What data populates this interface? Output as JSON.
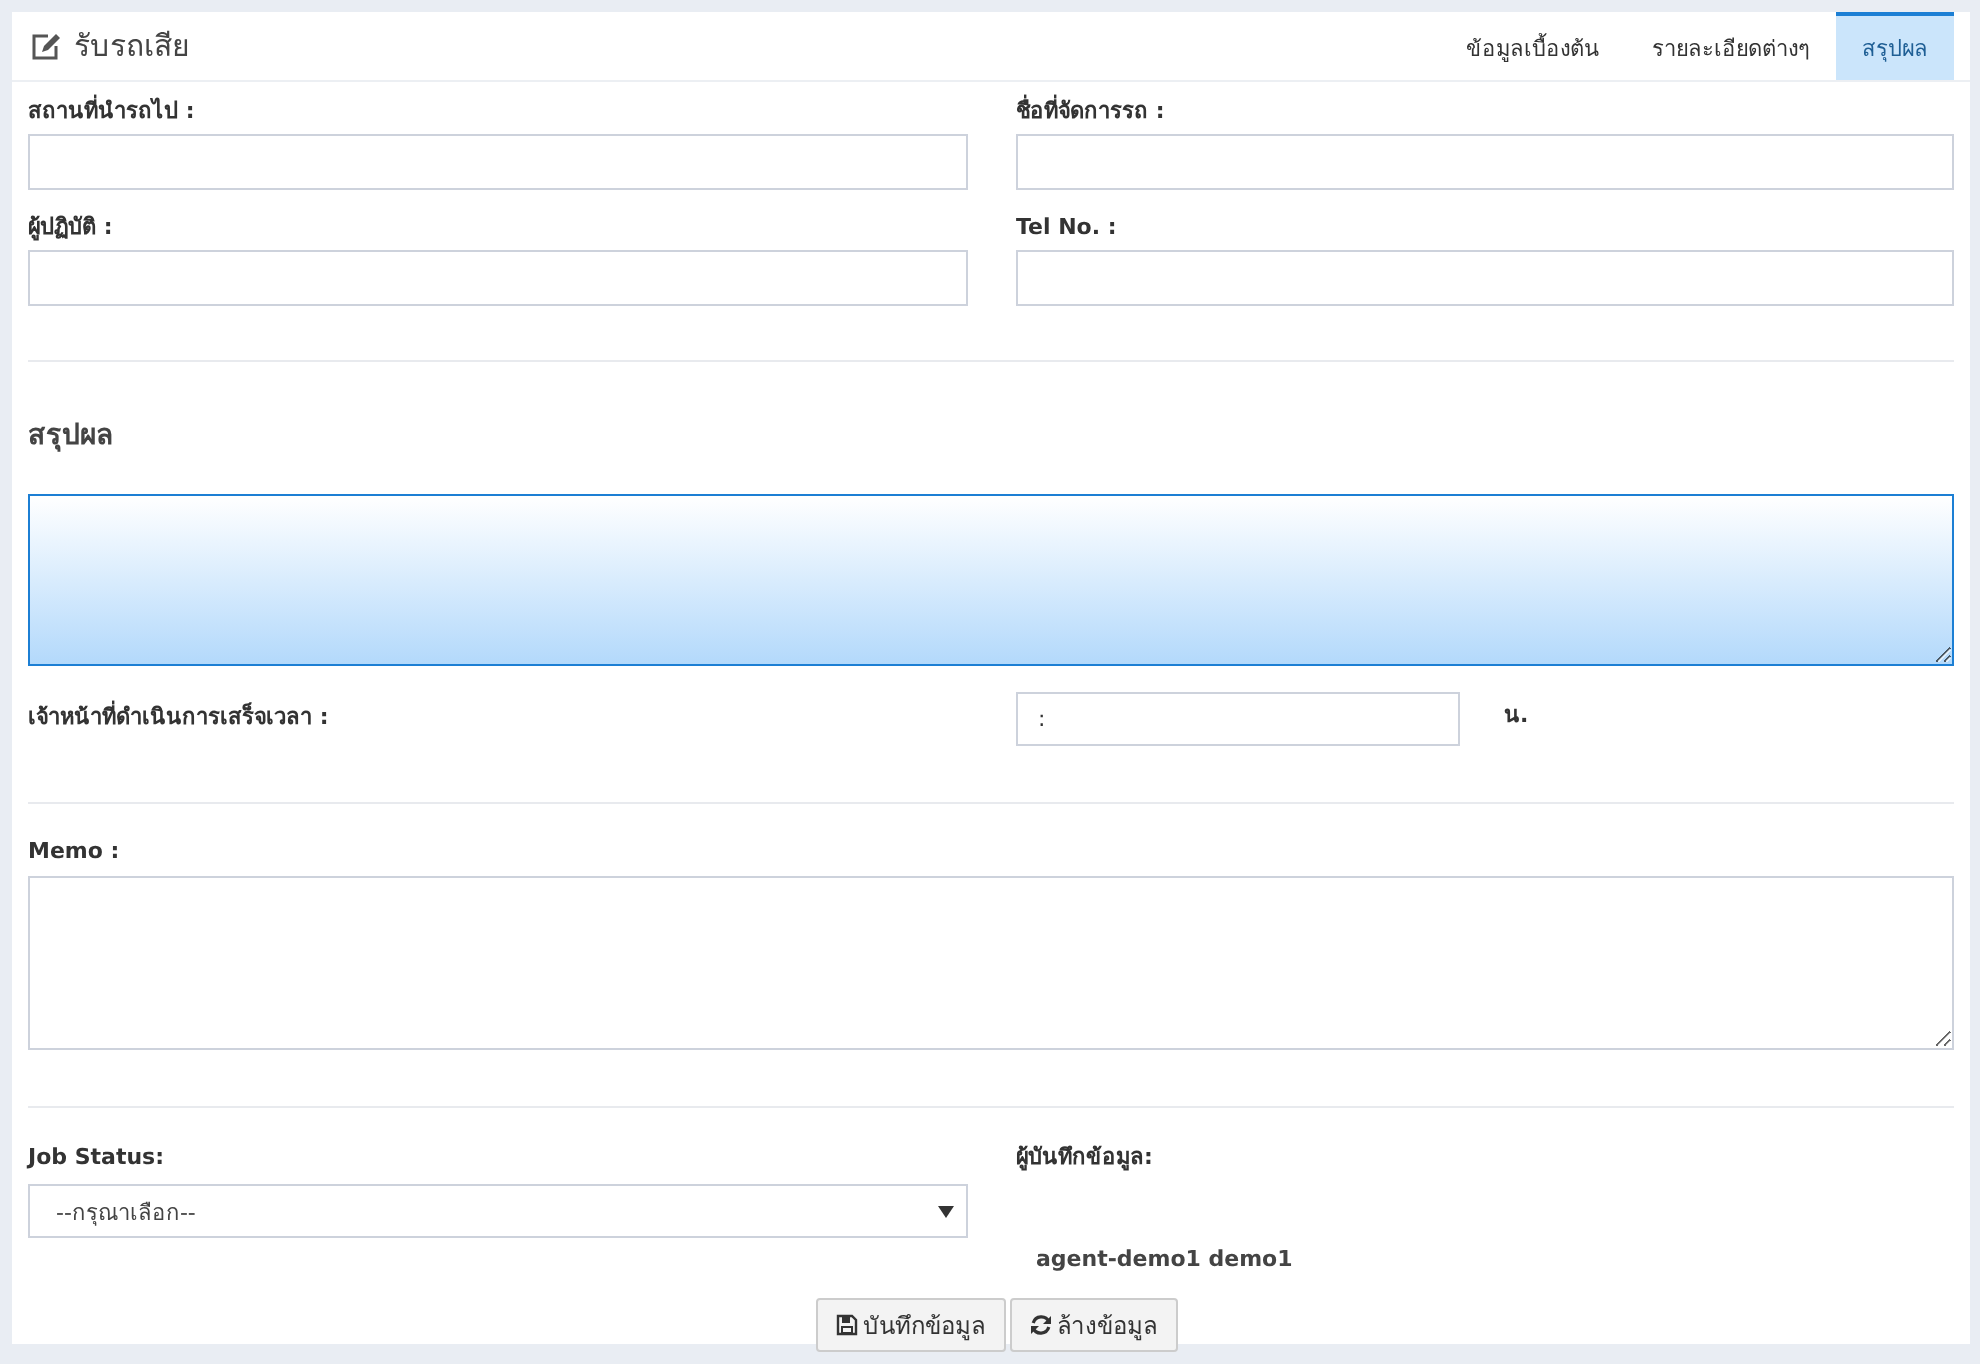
{
  "header": {
    "title": "รับรถเสีย"
  },
  "tabs": [
    {
      "label": "ข้อมูลเบื้องต้น",
      "selected": false
    },
    {
      "label": "รายละเอียดต่างๆ",
      "selected": false
    },
    {
      "label": "สรุปผล",
      "selected": true
    }
  ],
  "fields": [
    {
      "label": "สถานที่นำรถไป :"
    },
    {
      "label": "ชื่อที่จัดการรถ :"
    },
    {
      "label": "ผู้ปฏิบัติ :"
    },
    {
      "label": "Tel No. :"
    }
  ],
  "summary": {
    "heading": "สรุปผล",
    "focused": true
  },
  "finish_time": {
    "label": "เจ้าหน้าที่ดำเนินการเสร็จเวลา :",
    "value": ":",
    "unit": "น."
  },
  "memo": {
    "label": "Memo :"
  },
  "job_status": {
    "label": "Job Status:",
    "value": "--กรุณาเลือก--"
  },
  "recorder": {
    "label": "ผู้บันทึกข้อมูล:",
    "value": "agent-demo1 demo1"
  },
  "buttons": [
    {
      "label": "บันทึกข้อมูล",
      "kind": "save"
    },
    {
      "label": "ล้างข้อมูล",
      "kind": "reset"
    }
  ]
}
